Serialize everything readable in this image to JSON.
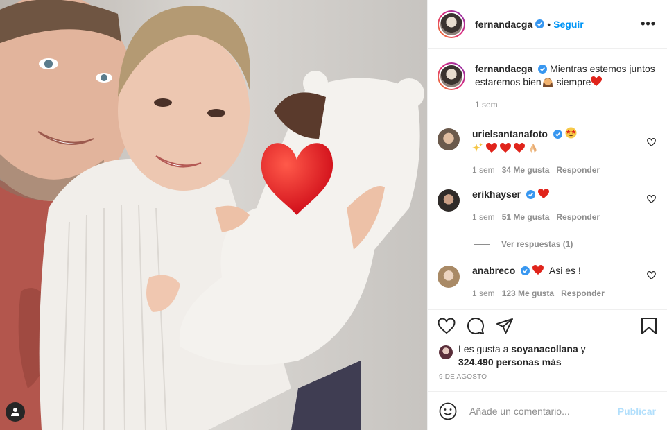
{
  "header": {
    "username": "fernandacga",
    "separator": "•",
    "follow_label": "Seguir",
    "more_label": "•••"
  },
  "caption": {
    "username": "fernandacga",
    "text_part1": "Mientras estemos juntos estaremos bien",
    "text_part2": " siempre",
    "time": "1 sem"
  },
  "comments": [
    {
      "username": "urielsantanafoto",
      "time": "1 sem",
      "likes": "34 Me gusta",
      "reply": "Responder",
      "avatar_color": "#6b5a4c"
    },
    {
      "username": "erikhayser",
      "time": "1 sem",
      "likes": "51 Me gusta",
      "reply": "Responder",
      "avatar_color": "#3a3633"
    },
    {
      "username": "anabreco",
      "text": "Asi es !",
      "time": "1 sem",
      "likes": "123 Me gusta",
      "reply": "Responder",
      "avatar_color": "#c9b49a"
    }
  ],
  "view_replies": "Ver respuestas (1)",
  "likes": {
    "prefix": "Les gusta a ",
    "user": "soyanacollana",
    "and": " y",
    "others": "324.490 personas más"
  },
  "date": "9 DE AGOSTO",
  "composer": {
    "placeholder": "Añade un comentario...",
    "post_label": "Publicar"
  },
  "colors": {
    "accent": "#0095f6",
    "verified": "#3897f0",
    "heart": "#ed4956",
    "muted": "#8e8e8e"
  }
}
